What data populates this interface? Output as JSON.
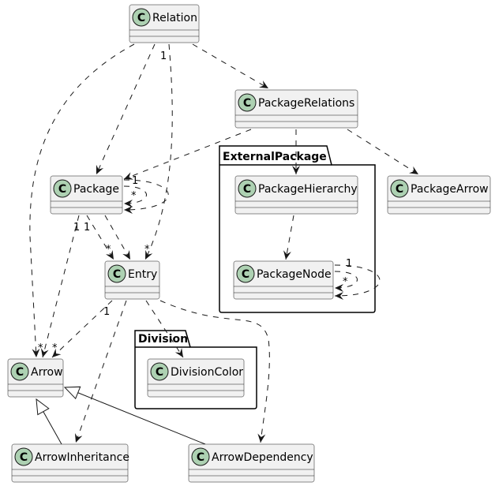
{
  "colors": {
    "class_fill": "#F1F1F1",
    "class_border": "#181818",
    "circle_fill": "#ADD1B2",
    "line": "#181818"
  },
  "packages": [
    {
      "id": "ExternalPackage",
      "name": "ExternalPackage"
    },
    {
      "id": "Division",
      "name": "Division"
    }
  ],
  "classes": [
    {
      "id": "Relation",
      "name": "Relation",
      "stereo_icon": "C"
    },
    {
      "id": "PackageRelations",
      "name": "PackageRelations",
      "stereo_icon": "C"
    },
    {
      "id": "Package",
      "name": "Package",
      "stereo_icon": "C"
    },
    {
      "id": "PackageHierarchy",
      "name": "PackageHierarchy",
      "stereo_icon": "C"
    },
    {
      "id": "PackageArrow",
      "name": "PackageArrow",
      "stereo_icon": "C"
    },
    {
      "id": "PackageNode",
      "name": "PackageNode",
      "stereo_icon": "C"
    },
    {
      "id": "Entry",
      "name": "Entry",
      "stereo_icon": "C"
    },
    {
      "id": "DivisionColor",
      "name": "DivisionColor",
      "stereo_icon": "C"
    },
    {
      "id": "Arrow",
      "name": "Arrow",
      "stereo_icon": "C"
    },
    {
      "id": "ArrowInheritance",
      "name": "ArrowInheritance",
      "stereo_icon": "C"
    },
    {
      "id": "ArrowDependency",
      "name": "ArrowDependency",
      "stereo_icon": "C"
    }
  ],
  "edges": [
    {
      "from": "Relation",
      "to": "Arrow",
      "type": "dependency"
    },
    {
      "from": "Relation",
      "to": "Package",
      "type": "dependency"
    },
    {
      "from": "Relation",
      "to": "Entry",
      "type": "dependency",
      "from_label": "1",
      "to_label": "*"
    },
    {
      "from": "Relation",
      "to": "PackageRelations",
      "type": "dependency"
    },
    {
      "from": "PackageRelations",
      "to": "Package",
      "type": "dependency",
      "to_label": "1"
    },
    {
      "from": "PackageRelations",
      "to": "PackageHierarchy",
      "type": "dependency"
    },
    {
      "from": "PackageRelations",
      "to": "PackageArrow",
      "type": "dependency"
    },
    {
      "from": "Package",
      "to": "Package",
      "type": "dependency",
      "to_label": "*"
    },
    {
      "from": "Package",
      "to": "Package",
      "type": "dependency"
    },
    {
      "from": "Package",
      "to": "Arrow",
      "type": "dependency",
      "from_label": "1",
      "to_label": "*"
    },
    {
      "from": "Package",
      "to": "Entry",
      "type": "dependency",
      "from_label": "1",
      "to_label": "*"
    },
    {
      "from": "Package",
      "to": "Entry",
      "type": "dependency"
    },
    {
      "from": "Entry",
      "to": "Arrow",
      "type": "dependency",
      "from_label": "1",
      "to_label": "*"
    },
    {
      "from": "Entry",
      "to": "ArrowInheritance",
      "type": "dependency"
    },
    {
      "from": "Entry",
      "to": "DivisionColor",
      "type": "dependency"
    },
    {
      "from": "Entry",
      "to": "ArrowDependency",
      "type": "dependency"
    },
    {
      "from": "PackageHierarchy",
      "to": "PackageNode",
      "type": "dependency"
    },
    {
      "from": "PackageNode",
      "to": "PackageNode",
      "type": "dependency",
      "from_label": "1",
      "to_label": "*"
    },
    {
      "from": "PackageNode",
      "to": "PackageNode",
      "type": "dependency"
    },
    {
      "from": "ArrowInheritance",
      "to": "Arrow",
      "type": "inheritance"
    },
    {
      "from": "ArrowDependency",
      "to": "Arrow",
      "type": "inheritance"
    }
  ]
}
